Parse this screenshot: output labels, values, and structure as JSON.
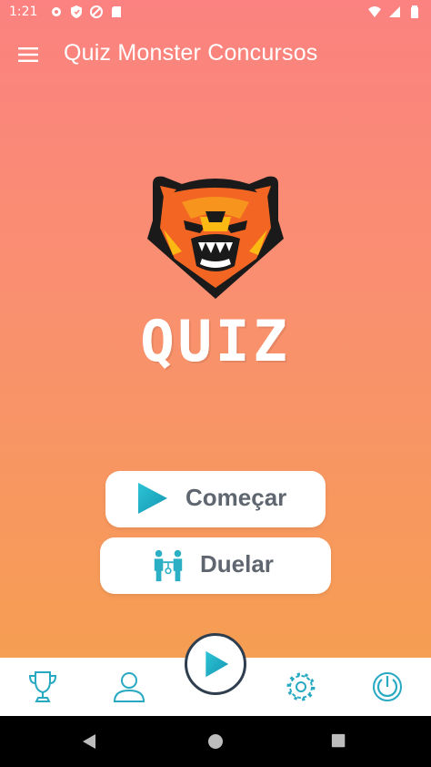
{
  "status_bar": {
    "time": "1:21",
    "left_icons": [
      "settings-icon",
      "shield-icon",
      "sync-icon",
      "sd-card-icon"
    ],
    "right_icons": [
      "wifi-icon",
      "signal-icon",
      "battery-icon"
    ]
  },
  "app_bar": {
    "title": "Quiz Monster Concursos",
    "menu_icon": "hamburger-menu-icon"
  },
  "logo": {
    "icon": "bear-mascot-icon",
    "word": "QUIZ"
  },
  "actions": {
    "start_label": "Começar",
    "duel_label": "Duelar"
  },
  "bottom_nav": {
    "items": [
      "trophy-icon",
      "user-icon",
      "play-icon",
      "gear-icon",
      "power-icon"
    ]
  },
  "system_nav": {
    "items": [
      "back-icon",
      "home-icon",
      "recents-icon"
    ]
  },
  "colors": {
    "gradient_top": "#FB8280",
    "gradient_bottom": "#F5A24A",
    "accent": "#1BB1C8",
    "button_text": "#5F6670",
    "nav_icon": "#28A9C2"
  }
}
